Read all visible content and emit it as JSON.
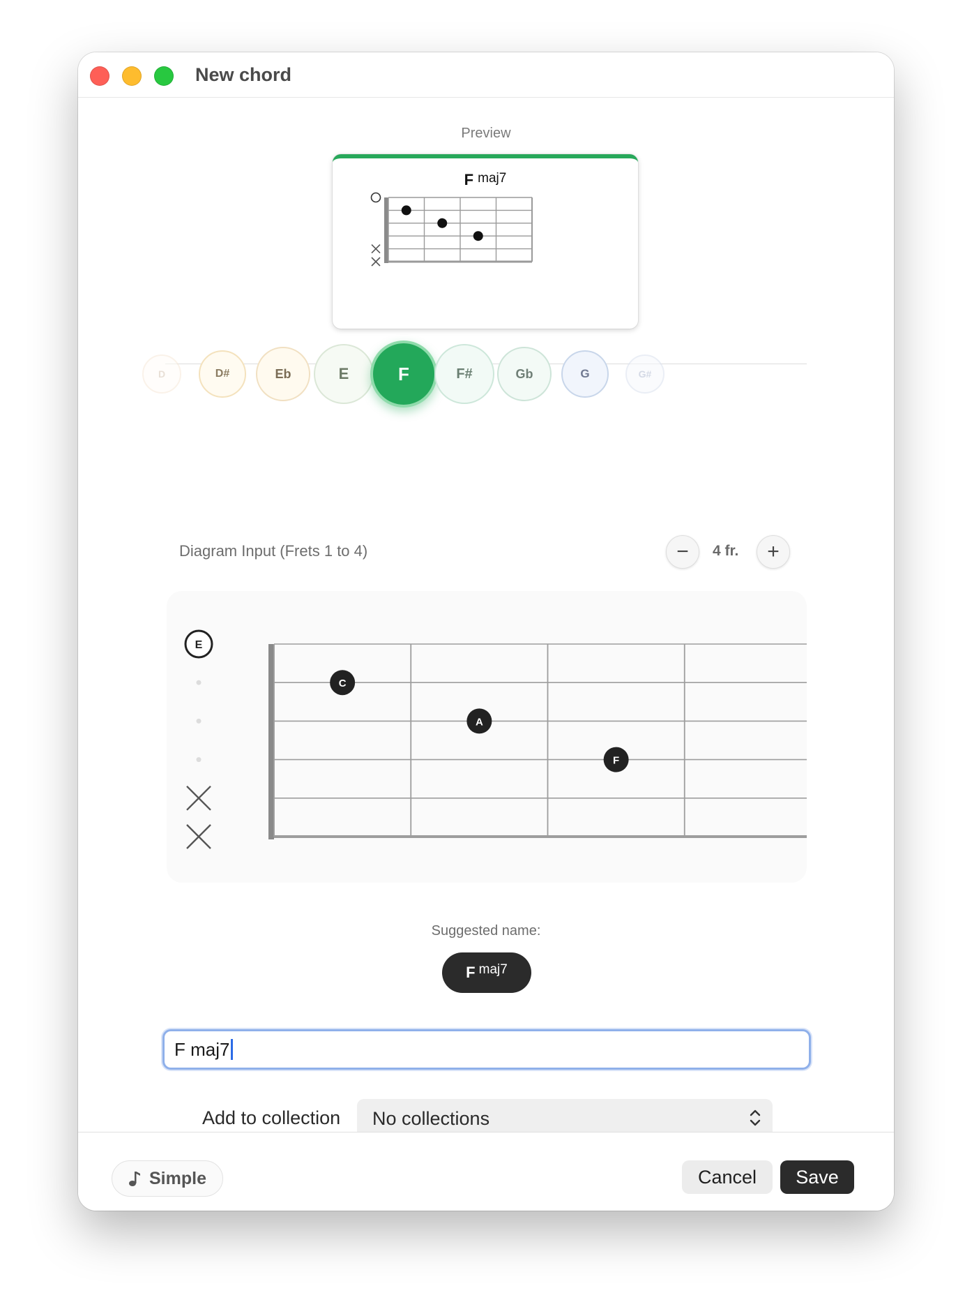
{
  "window": {
    "title": "New chord"
  },
  "preview": {
    "label": "Preview",
    "accent_color": "#27a85a",
    "chord_root": "F",
    "chord_quality": "maj7"
  },
  "key_selector": {
    "keys": [
      "D",
      "D#",
      "Eb",
      "E",
      "F",
      "F#",
      "Gb",
      "G",
      "G#"
    ],
    "selected": "F"
  },
  "diagram_input": {
    "label": "Diagram Input (Frets 1 to 4)",
    "fret_count_label": "4 fr.",
    "decrement_symbol": "−",
    "increment_symbol": "+",
    "frets_shown": 4,
    "strings": [
      {
        "state": "open",
        "label": "E"
      },
      {
        "state": "fretted",
        "fret": 1,
        "note": "C"
      },
      {
        "state": "fretted",
        "fret": 2,
        "note": "A"
      },
      {
        "state": "fretted",
        "fret": 3,
        "note": "F"
      },
      {
        "state": "muted"
      },
      {
        "state": "muted"
      }
    ]
  },
  "suggested": {
    "label": "Suggested name:",
    "chord_root": "F",
    "chord_quality": "maj7"
  },
  "name_field": {
    "value": "F maj7"
  },
  "collection": {
    "label": "Add to collection",
    "selected": "No collections"
  },
  "footer": {
    "simple_label": "Simple",
    "cancel_label": "Cancel",
    "save_label": "Save"
  }
}
